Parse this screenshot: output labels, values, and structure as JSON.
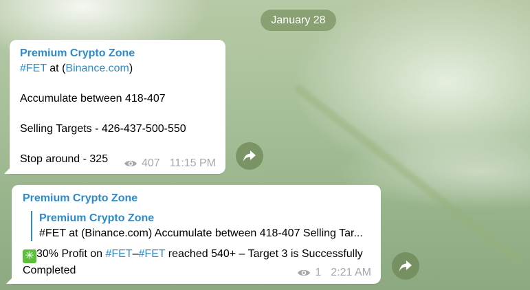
{
  "date_separator": "January 28",
  "messages": [
    {
      "sender": "Premium Crypto Zone",
      "hashtag": "#FET",
      "at_text": " at (",
      "site": "Binance.com",
      "close_paren": ")",
      "line_accumulate": "Accumulate between 418-407",
      "line_targets": "Selling Targets - 426-437-500-550",
      "line_stop": "Stop around - 325",
      "views": "407",
      "time": "11:15 PM"
    },
    {
      "sender": "Premium Crypto Zone",
      "reply": {
        "sender": "Premium Crypto Zone",
        "quote": "#FET at (Binance.com)  Accumulate between 418-407  Selling Tar..."
      },
      "check_emoji": "✳",
      "text_part1": "30% Profit on ",
      "hashtag1": "#FET",
      "dash": "–",
      "hashtag2": "#FET",
      "text_part2": " reached 540+ – Target 3 is Successfully Completed",
      "views": "1",
      "time": "2:21 AM"
    }
  ],
  "icons": {
    "views": "eye-icon",
    "forward": "share-arrow-icon"
  },
  "colors": {
    "link": "#2d8bc9",
    "meta": "#a3a8ad",
    "check_emoji_bg": "#5cbf3c"
  }
}
